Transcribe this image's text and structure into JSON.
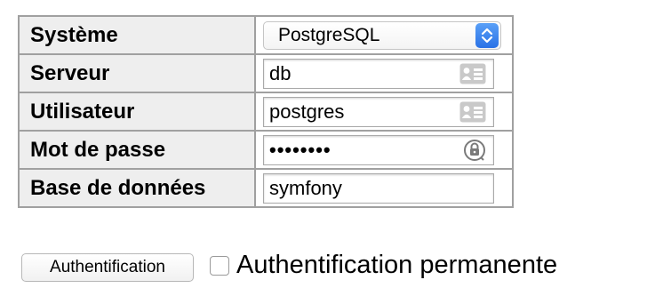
{
  "form": {
    "system": {
      "label": "Système",
      "value": "PostgreSQL"
    },
    "server": {
      "label": "Serveur",
      "value": "db",
      "icon": "contact-card-icon"
    },
    "username": {
      "label": "Utilisateur",
      "value": "postgres",
      "icon": "contact-card-icon"
    },
    "password": {
      "label": "Mot de passe",
      "value": "••••••••",
      "icon": "key-icon"
    },
    "database": {
      "label": "Base de données",
      "value": "symfony"
    }
  },
  "actions": {
    "submit_label": "Authentification",
    "permanent_label": "Authentification permanente",
    "permanent_checked": false
  },
  "colors": {
    "select_arrow": "#2a72e6",
    "border": "#a0a0a0",
    "header_bg": "#eeeeee"
  }
}
